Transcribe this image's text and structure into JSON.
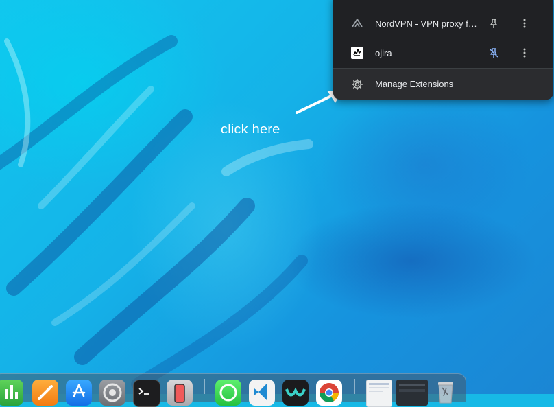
{
  "annotation": {
    "text": "click here"
  },
  "extensions_menu": {
    "items": [
      {
        "name": "NordVPN - VPN proxy fo...",
        "icon": "nordvpn-icon",
        "pinned": false
      },
      {
        "name": "ojira",
        "icon": "ojira-icon",
        "pinned": true
      }
    ],
    "manage_label": "Manage Extensions",
    "accent_color": "#8ab4f8"
  },
  "dock": {
    "apps": [
      {
        "name": "numbers-icon"
      },
      {
        "name": "pages-icon"
      },
      {
        "name": "app-store-icon"
      },
      {
        "name": "system-settings-icon"
      },
      {
        "name": "terminal-icon"
      },
      {
        "name": "iphone-mirroring-icon"
      },
      {
        "name": "whatsapp-icon"
      },
      {
        "name": "vscode-icon"
      },
      {
        "name": "webex-icon"
      },
      {
        "name": "chrome-icon"
      },
      {
        "name": "recent-window-icon"
      },
      {
        "name": "recent-window-icon"
      },
      {
        "name": "trash-icon"
      }
    ]
  }
}
